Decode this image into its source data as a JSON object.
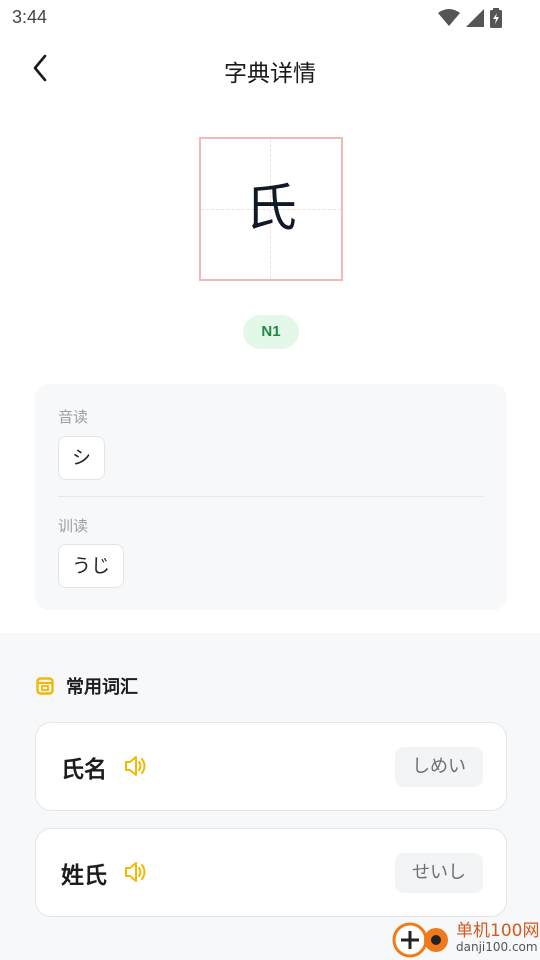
{
  "status_bar": {
    "time": "3:44"
  },
  "header": {
    "title": "字典详情"
  },
  "character": {
    "glyph": "氏",
    "level": "N1"
  },
  "readings": {
    "on_label": "音读",
    "on_values": [
      "シ"
    ],
    "kun_label": "训读",
    "kun_values": [
      "うじ"
    ]
  },
  "vocab": {
    "title": "常用词汇",
    "items": [
      {
        "word": "氏名",
        "kana": "しめい"
      },
      {
        "word": "姓氏",
        "kana": "せいし"
      }
    ]
  },
  "watermark": {
    "name": "单机100网",
    "url": "danji100.com"
  },
  "colors": {
    "accent": "#f5b800",
    "badge_bg": "#e3f8e8",
    "badge_text": "#1f8a44",
    "grid_border": "#f3b9b9"
  }
}
